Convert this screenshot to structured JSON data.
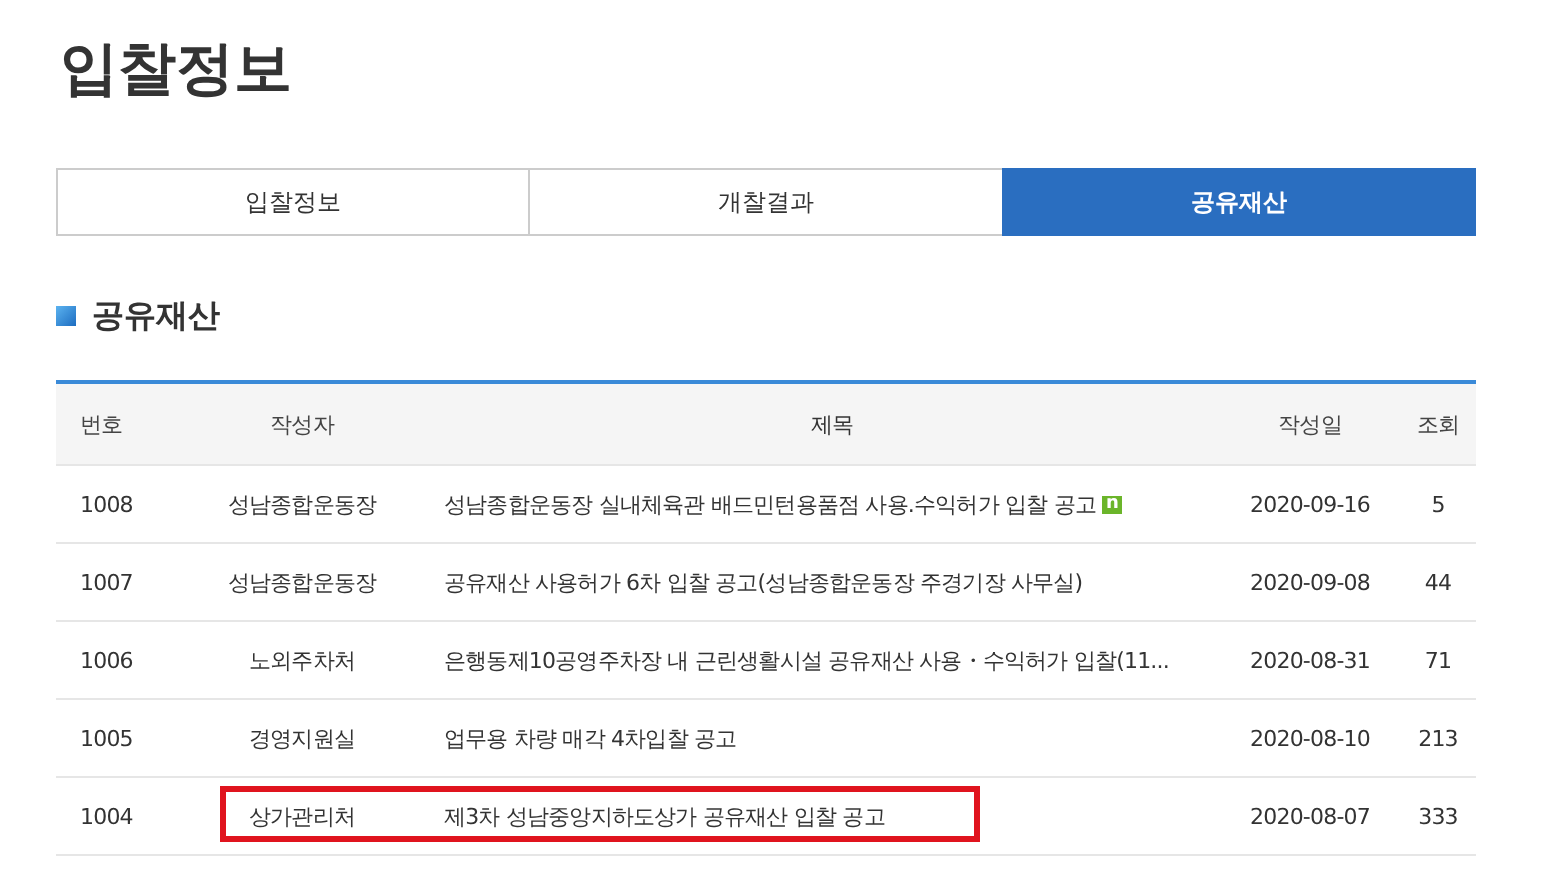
{
  "page_title": "입찰정보",
  "tabs": [
    {
      "label": "입찰정보",
      "selected": false
    },
    {
      "label": "개찰결과",
      "selected": false
    },
    {
      "label": "공유재산",
      "selected": true
    }
  ],
  "section_title": "공유재산",
  "table": {
    "columns": [
      "번호",
      "작성자",
      "제목",
      "작성일",
      "조회"
    ],
    "rows": [
      {
        "number": "1008",
        "writer": "성남종합운동장",
        "title": "성남종합운동장 실내체육관 배드민턴용품점 사용.수익허가 입찰 공고",
        "badge": "n",
        "date": "2020-09-16",
        "views": "5",
        "highlighted": false
      },
      {
        "number": "1007",
        "writer": "성남종합운동장",
        "title": "공유재산 사용허가 6차 입찰 공고(성남종합운동장 주경기장 사무실)",
        "date": "2020-09-08",
        "views": "44",
        "highlighted": false
      },
      {
        "number": "1006",
        "writer": "노외주차처",
        "title": "은행동제10공영주차장 내 근린생활시설 공유재산 사용・수익허가 입찰(11...",
        "date": "2020-08-31",
        "views": "71",
        "highlighted": false
      },
      {
        "number": "1005",
        "writer": "경영지원실",
        "title": "업무용 차량 매각 4차입찰 공고",
        "date": "2020-08-10",
        "views": "213",
        "highlighted": false
      },
      {
        "number": "1004",
        "writer": "상가관리처",
        "title": "제3차 성남중앙지하도상가 공유재산 입찰 공고",
        "date": "2020-08-07",
        "views": "333",
        "highlighted": true
      }
    ]
  }
}
